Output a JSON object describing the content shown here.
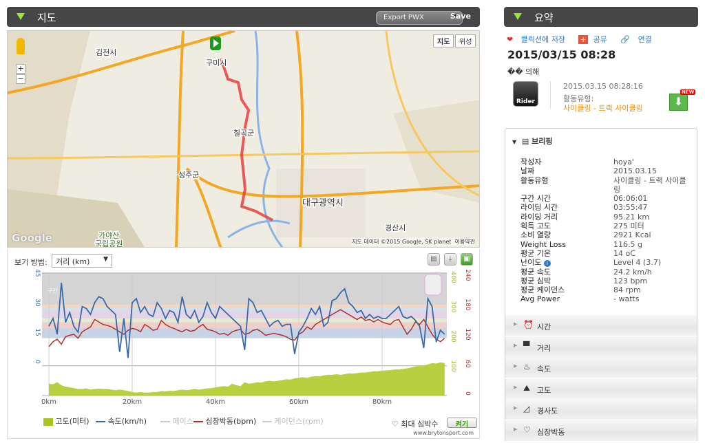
{
  "map_panel": {
    "title": "지도",
    "export_label": "Export PWX",
    "save_label": "Save",
    "map_type_map": "지도",
    "map_type_satellite": "위성",
    "zoom_in": "+",
    "zoom_out": "−",
    "google": "Google",
    "attribution": "지도 데이터 ©2015 Google, SK planet",
    "terms": "이용약관",
    "places": [
      "김천시",
      "구미시",
      "칠곡군",
      "성주군",
      "대구광역시",
      "경산시",
      "가야산",
      "국립공원"
    ]
  },
  "chart_panel": {
    "view_label": "보기 방법:",
    "view_value": "거리 (km)",
    "zone_label": "구간",
    "max_hr_label": "최대 심박수",
    "on_label": "켜기",
    "site": "www.brytonsport.com",
    "legend": [
      {
        "label": "고도(미터)",
        "color": "#a8c520"
      },
      {
        "label": "속도(km/h)",
        "color": "#3a68a8"
      },
      {
        "label": "페이스",
        "color": "#ccc"
      },
      {
        "label": "심장박동(bpm)",
        "color": "#b03030"
      },
      {
        "label": "케이던스(rpm)",
        "color": "#ccc"
      }
    ]
  },
  "chart_data": {
    "type": "line",
    "x_label_unit": "km",
    "x_ticks": [
      "0km",
      "20km",
      "40km",
      "60km",
      "80km"
    ],
    "x_tick_values": [
      0,
      20,
      40,
      60,
      80
    ],
    "xlim": [
      0,
      95
    ],
    "speed_ticks": [
      "45",
      "30",
      "15",
      "0"
    ],
    "hr_ticks": [
      "240",
      "180",
      "120",
      "60",
      "0"
    ],
    "elev_ticks": [
      "400",
      "300",
      "200",
      "100"
    ],
    "speed_kmh": [
      18,
      22,
      14,
      40,
      20,
      25,
      18,
      15,
      28,
      27,
      24,
      30,
      33,
      32,
      28,
      26,
      24,
      5,
      22,
      2,
      30,
      32,
      25,
      28,
      24,
      23,
      30,
      27,
      22,
      26,
      25,
      20,
      33,
      24,
      22,
      26,
      20,
      23,
      30,
      25,
      22,
      28,
      26,
      24,
      22,
      20,
      18,
      6,
      32,
      30,
      25,
      26,
      22,
      18,
      20,
      21,
      18,
      19,
      19,
      4,
      15,
      18,
      22,
      27,
      24,
      28,
      18,
      20,
      31,
      32,
      35,
      37,
      30,
      28,
      25,
      26,
      22,
      24,
      22,
      23,
      22,
      22,
      24,
      26,
      28,
      23,
      22,
      23,
      21,
      18,
      7,
      32,
      28,
      10,
      16,
      14
    ],
    "heart_rate_bpm": [
      95,
      105,
      110,
      100,
      115,
      118,
      120,
      112,
      125,
      130,
      135,
      150,
      145,
      140,
      138,
      135,
      130,
      125,
      120,
      128,
      132,
      130,
      125,
      140,
      135,
      128,
      130,
      148,
      140,
      135,
      132,
      128,
      125,
      130,
      126,
      128,
      135,
      140,
      130,
      128,
      125,
      120,
      122,
      118,
      125,
      128,
      130,
      120,
      122,
      128,
      130,
      125,
      118,
      120,
      122,
      120,
      118,
      115,
      110,
      108,
      120,
      125,
      135,
      130,
      140,
      145,
      150,
      155,
      160,
      165,
      170,
      165,
      160,
      155,
      150,
      155,
      148,
      150,
      145,
      150,
      145,
      142,
      140,
      148,
      150,
      135,
      120,
      130,
      145,
      140,
      150,
      135,
      120,
      110,
      105,
      112
    ],
    "elevation_m": [
      40,
      38,
      45,
      35,
      30,
      28,
      25,
      22,
      22,
      24,
      20,
      22,
      23,
      22,
      22,
      20,
      18,
      20,
      18,
      15,
      12,
      10,
      12,
      10,
      10,
      12,
      12,
      15,
      14,
      16,
      15,
      18,
      20,
      18,
      20,
      22,
      20,
      22,
      24,
      25,
      28,
      30,
      32,
      30,
      40,
      35,
      32,
      45,
      40,
      42,
      45,
      44,
      48,
      50,
      48,
      50,
      52,
      55,
      54,
      58,
      60,
      62,
      60,
      64,
      66,
      65,
      68,
      70,
      70,
      72,
      70,
      72,
      75,
      74,
      76,
      78,
      78,
      80,
      82,
      82,
      84,
      85,
      86,
      88,
      88,
      90,
      92,
      95,
      98,
      100,
      102,
      105,
      110,
      108,
      112,
      110
    ]
  },
  "summary": {
    "title": "요약",
    "save_collection": "클릭션에 저장",
    "share": "공유",
    "link": "연결",
    "datetime": "2015/03/15 08:28",
    "by": "�� 의해",
    "device": "Rider",
    "timestamp": "2015.03.15 08:28:16",
    "activity_type_label": "활동유형:",
    "activity_type": "사이클링 - 트랙 사이클링",
    "new_badge": "NEW",
    "briefing_title": "브리핑",
    "briefing": [
      {
        "k": "작성자",
        "v": "hoya'"
      },
      {
        "k": "날짜",
        "v": "2015.03.15"
      },
      {
        "k": "활동유형",
        "v": "사이클링 - 트랙 사이클링"
      },
      {
        "k": "구간 시간",
        "v": "06:06:01"
      },
      {
        "k": "라이딩 시간",
        "v": "03:55:47"
      },
      {
        "k": "라이딩 거리",
        "v": "95.21 km"
      },
      {
        "k": "획득 고도",
        "v": "275 미터"
      },
      {
        "k": "소비 열량",
        "v": "2921 Kcal"
      },
      {
        "k": "Weight Loss",
        "v": "116.5 g"
      },
      {
        "k": "평균 기온",
        "v": "14 oC"
      },
      {
        "k": "난이도",
        "v": "Level 4 (3.7)"
      },
      {
        "k": "평균 속도",
        "v": "24.2 km/h"
      },
      {
        "k": "평균 심박",
        "v": "123 bpm"
      },
      {
        "k": "평균 케이던스",
        "v": "84 rpm"
      },
      {
        "k": "Avg Power",
        "v": "- watts"
      }
    ],
    "sections": [
      {
        "label": "시간",
        "icon": "⏰"
      },
      {
        "label": "거리",
        "icon": "▀"
      },
      {
        "label": "속도",
        "icon": "♨"
      },
      {
        "label": "고도",
        "icon": "⛰"
      },
      {
        "label": "경사도",
        "icon": "◿"
      },
      {
        "label": "심장박동",
        "icon": "♡"
      }
    ]
  }
}
